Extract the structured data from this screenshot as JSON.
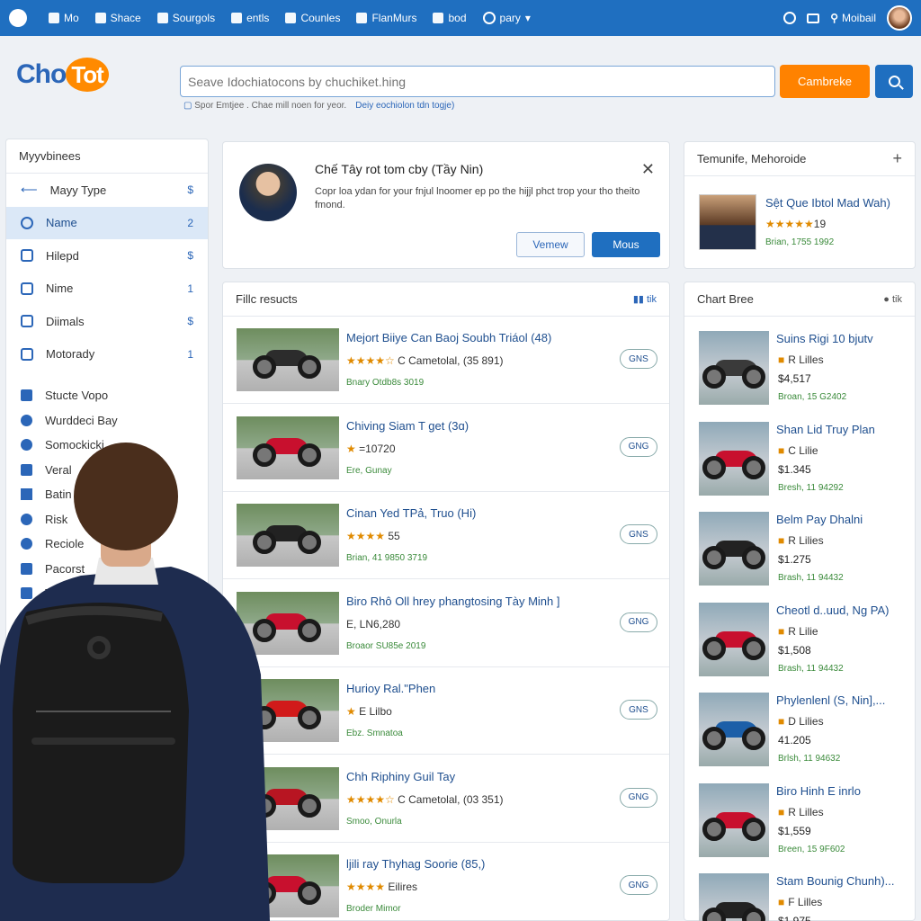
{
  "topbar": {
    "items": [
      "Mo",
      "Shace",
      "Sourgols",
      "entls",
      "Counles",
      "FlanMurs",
      "bod",
      "pary"
    ],
    "user_label": "Moibail"
  },
  "header": {
    "brand_part1": "Cho",
    "brand_part2": "Tot",
    "search_placeholder": "Seave Idochiatocons by chuchiket.hing",
    "cta_label": "Cambreke",
    "hint_text": "Spor Emtjee . Chae mill noen for yeor.",
    "hint_link": "Deiy eochiolon tdn togje)"
  },
  "sidebar": {
    "title": "Myyvbinees",
    "items": [
      {
        "label": "Mayy Type",
        "count": "$"
      },
      {
        "label": "Name",
        "count": "2"
      },
      {
        "label": "Hilepd",
        "count": "$"
      },
      {
        "label": "Nime",
        "count": "1"
      },
      {
        "label": "Diimals",
        "count": "$"
      },
      {
        "label": "Motorady",
        "count": "1"
      }
    ],
    "sub_items": [
      "Stucte Vopo",
      "Wurddeci Bay",
      "Somockicki",
      "Veral",
      "Batin",
      "Risk",
      "Reciole",
      "Pacorst",
      "Tru"
    ]
  },
  "notice": {
    "title": "Chế Tây rot tom cby (Tầy Nin)",
    "body": "Copr loa ydan for your fnjul lnoomer ep po the hijjl phct trop your tho theito fmond.",
    "btn_secondary": "Vemew",
    "btn_primary": "Mous"
  },
  "profile": {
    "title": "Temunife, Mehoroide",
    "name": "Sệt Que Ibtol Mad Wah)",
    "rating": "★★★★★",
    "rating_value": "19",
    "meta": "Brian, 1755 1992"
  },
  "results": {
    "title": "Fillc resucts",
    "items": [
      {
        "title": "Mejort Biiye Can Baoj Soubh Triáol (48)",
        "stars": "★★★★☆",
        "sub": "C Cametolal, (35 891)",
        "meta": "Bnary Otdb8s 3019",
        "pill": "GNS",
        "color": "#2c2c2c"
      },
      {
        "title": "Chiving Siam T get (3ɑ)",
        "stars": "★",
        "sub": "=10720",
        "meta": "Ere, Gunay",
        "pill": "GNG",
        "color": "#c8102e"
      },
      {
        "title": "Cinan Yed TPả, Truo (Hi)",
        "stars": "★★★★",
        "sub": "55",
        "meta": "Brian, 41 9850 3719",
        "pill": "GNS",
        "color": "#222222"
      },
      {
        "title": "Biro Rhô Oll hrey phangtosing Tày Minh ]",
        "stars": "",
        "sub": "E, LN6,280",
        "meta": "Broaor SU85e 2019",
        "pill": "GNG",
        "color": "#c8102e"
      },
      {
        "title": "Hurioy Ral.\"Phen",
        "stars": "★",
        "sub": "E Lilbo",
        "meta": "Ebz. Smnatoa",
        "pill": "GNS",
        "color": "#d11a1a"
      },
      {
        "title": "Chh Riphiny Guil Tay",
        "stars": "★★★★☆",
        "sub": "C Cametolal, (03 351)",
        "meta": "Smoo, Onurla",
        "pill": "GNG",
        "color": "#b81522"
      },
      {
        "title": "ljili ray Thyhag Soorie (85,)",
        "stars": "★★★★",
        "sub": "Eilires",
        "meta": "Broder Mimor",
        "pill": "GNG",
        "color": "#c8102e"
      }
    ]
  },
  "chart_panel": {
    "title": "Chart Bree",
    "items": [
      {
        "title": "Suins Rigi 10 bjutv",
        "rating": "R Lilles",
        "price": "$4,517",
        "meta": "Broan, 15 G2402",
        "color": "#3a3a3a"
      },
      {
        "title": "Shan Lid Truy Plan",
        "rating": "C Lilie",
        "price": "$1.345",
        "meta": "Bresh, 11 94292",
        "color": "#c8102e"
      },
      {
        "title": "Belm Pay Dhalni",
        "rating": "R Lilies",
        "price": "$1.275",
        "meta": "Brash, 11 94432",
        "color": "#222222"
      },
      {
        "title": "Cheotl d..uud, Ng PA)",
        "rating": "R Lilie",
        "price": "$1,508",
        "meta": "Brash, 11 94432",
        "color": "#c8102e"
      },
      {
        "title": "Phylenlenl (S, Nin],...",
        "rating": "D Lilies",
        "price": "41.205",
        "meta": "Brlsh, 11 94632",
        "color": "#1c5fa8"
      },
      {
        "title": "Biro Hinh E inrlo",
        "rating": "R Lilles",
        "price": "$1,559",
        "meta": "Breen, 15 9F602",
        "color": "#c8102e"
      },
      {
        "title": "Stam Bounig Chunh)...",
        "rating": "F Lilles",
        "price": "$1.975",
        "meta": "",
        "color": "#222222"
      }
    ]
  }
}
